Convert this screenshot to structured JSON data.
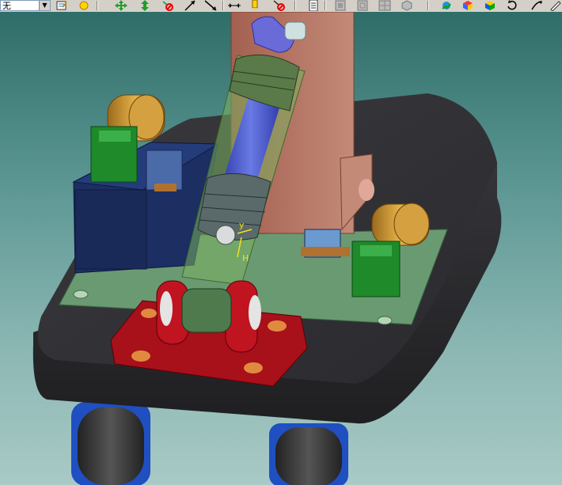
{
  "toolbar": {
    "layer_value": "无",
    "buttons": [
      {
        "icon": "layer-properties-icon"
      },
      {
        "icon": "light-bulb-icon"
      },
      {
        "icon": "pan-icon"
      },
      {
        "icon": "zoom-arrows-icon"
      },
      {
        "icon": "no-entry-icon"
      },
      {
        "icon": "arrow-tool-icon"
      },
      {
        "icon": "line-tool-icon"
      },
      {
        "icon": "dimension-arrow-icon"
      },
      {
        "icon": "pencil-icon"
      },
      {
        "icon": "no-entry-icon"
      },
      {
        "icon": "document-icon"
      },
      {
        "icon": "view-front-icon"
      },
      {
        "icon": "view-side-icon"
      },
      {
        "icon": "view-grid-icon"
      },
      {
        "icon": "view-iso-icon"
      },
      {
        "icon": "render-icon"
      },
      {
        "icon": "cube-icon"
      },
      {
        "icon": "shaded-cube-icon"
      },
      {
        "icon": "rotate-icon"
      },
      {
        "icon": "sketch-icon"
      }
    ]
  },
  "viewport": {
    "triad_labels": {
      "y": "y",
      "h": "H"
    }
  }
}
